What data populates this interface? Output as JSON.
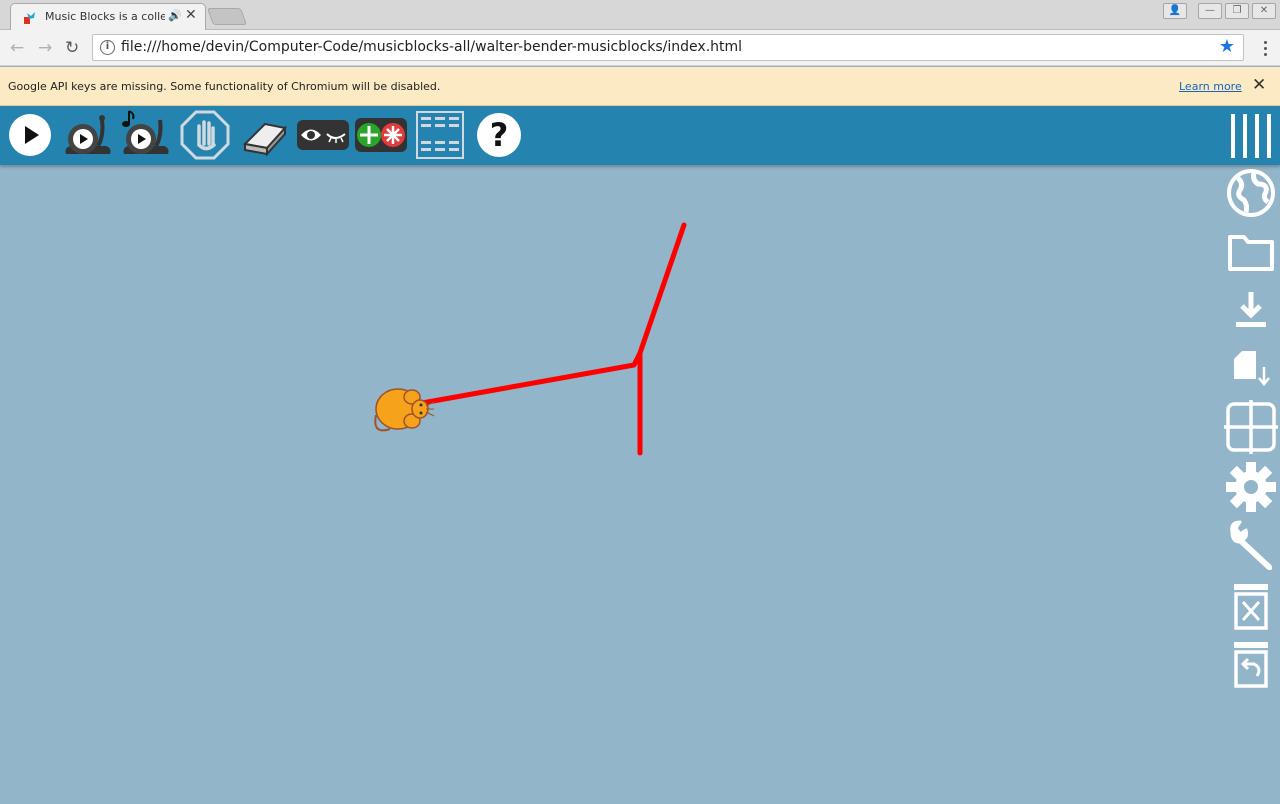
{
  "browser": {
    "tab_title": "Music Blocks is a collection",
    "tab_audio_icon": "speaker-icon",
    "url": "file:///home/devin/Computer-Code/musicblocks-all/walter-bender-musicblocks/index.html"
  },
  "infobar": {
    "message": "Google API keys are missing. Some functionality of Chromium will be disabled.",
    "link_label": "Learn more"
  },
  "toolbar": {
    "buttons": [
      "play-icon",
      "run-slow-icon",
      "run-music-slow-icon",
      "stop-icon",
      "clear-icon",
      "hide-blocks-icon",
      "collapse-blocks-icon",
      "palette-grid-icon",
      "help-icon"
    ],
    "menu_icon": "hamburger-icon"
  },
  "sidebar": {
    "buttons": [
      "planet-icon",
      "open-file-icon",
      "save-icon",
      "new-file-icon",
      "grid-icon",
      "settings-icon",
      "tools-icon",
      "delete-icon",
      "restore-icon"
    ]
  },
  "canvas": {
    "background": "#92b5c9",
    "pen_color": "#ff0000",
    "turtle": "mouse-icon"
  },
  "colors": {
    "toolbar": "#2584af",
    "accent_star": "#1a73e8"
  }
}
